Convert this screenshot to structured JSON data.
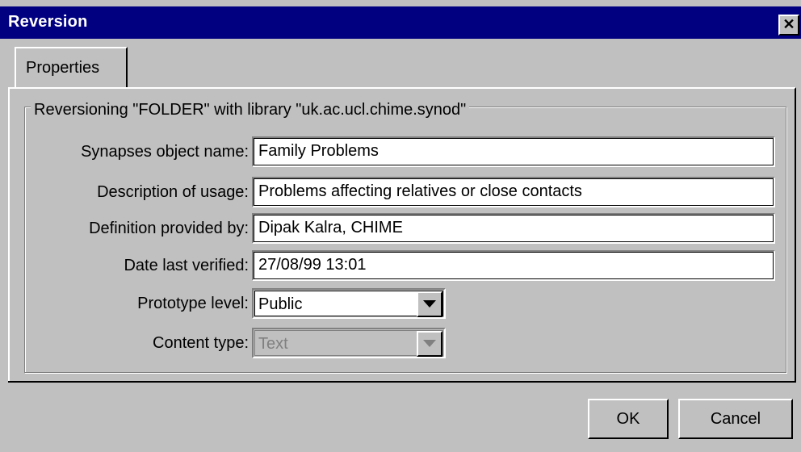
{
  "window": {
    "title": "Reversion",
    "close_glyph": "✕"
  },
  "tabs": [
    {
      "label": "Properties",
      "active": true
    }
  ],
  "group": {
    "legend": "Reversioning \"FOLDER\" with library \"uk.ac.ucl.chime.synod\""
  },
  "fields": {
    "object_name": {
      "label": "Synapses object name:",
      "value": "Family Problems"
    },
    "description": {
      "label": "Description of usage:",
      "value": "Problems affecting relatives or close contacts"
    },
    "definition": {
      "label": "Definition provided by:",
      "value": "Dipak Kalra, CHIME"
    },
    "date_verified": {
      "label": "Date last verified:",
      "value": "27/08/99 13:01"
    },
    "prototype_level": {
      "label": "Prototype level:",
      "value": "Public",
      "enabled": true
    },
    "content_type": {
      "label": "Content type:",
      "value": "Text",
      "enabled": false
    }
  },
  "buttons": {
    "ok": "OK",
    "cancel": "Cancel"
  },
  "colors": {
    "title_bar": "#000080",
    "face": "#c0c0c0",
    "disabled_text": "#808080"
  }
}
